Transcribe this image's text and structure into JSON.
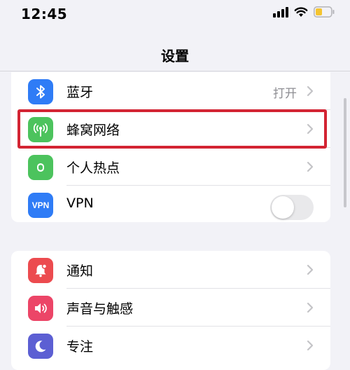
{
  "status_bar": {
    "time": "12:45",
    "icons": [
      "signal-icon",
      "wifi-icon",
      "battery-icon"
    ],
    "battery_color": "#f4c430"
  },
  "nav": {
    "title": "设置"
  },
  "groups": [
    {
      "items": [
        {
          "label": "蓝牙",
          "value": "打开",
          "icon": "bluetooth-icon",
          "color": "#2f7cf6"
        },
        {
          "label": "蜂窝网络",
          "value": "",
          "icon": "cellular-antenna-icon",
          "color": "#4cc35d",
          "highlighted": true
        },
        {
          "label": "个人热点",
          "value": "",
          "icon": "hotspot-icon",
          "color": "#4cc35d"
        },
        {
          "label": "VPN",
          "value": "",
          "icon": "vpn-icon",
          "icon_text": "VPN",
          "color": "#2f7cf6",
          "toggle": false
        }
      ]
    },
    {
      "items": [
        {
          "label": "通知",
          "value": "",
          "icon": "notifications-icon",
          "color": "#ec4b4f"
        },
        {
          "label": "声音与触感",
          "value": "",
          "icon": "sound-icon",
          "color": "#ec4567"
        },
        {
          "label": "专注",
          "value": "",
          "icon": "focus-moon-icon",
          "color": "#5c5fd3"
        }
      ]
    }
  ],
  "colors": {
    "highlight": "#d32433",
    "background": "#f2f2f7"
  }
}
